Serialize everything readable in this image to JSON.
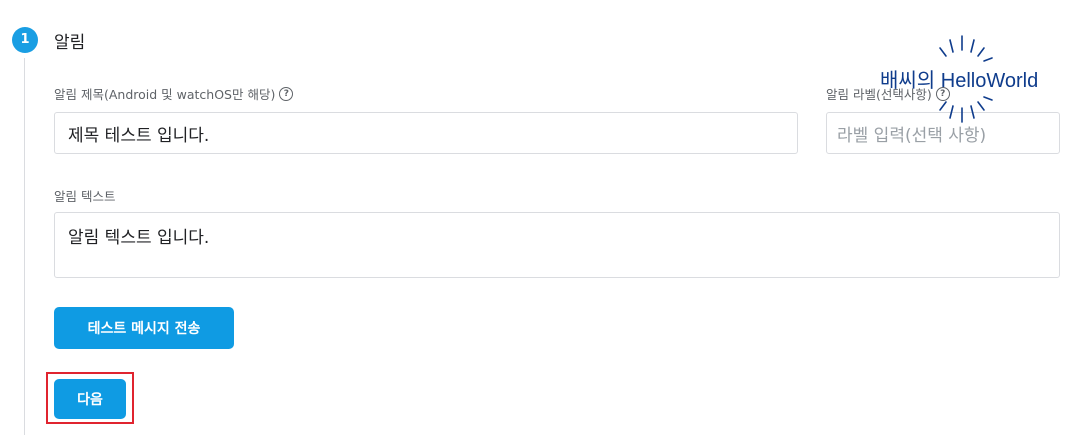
{
  "step": {
    "number": "1",
    "title": "알림"
  },
  "fields": {
    "title_label": "알림 제목(Android 및 watchOS만 해당)",
    "title_value": "제목 테스트 입니다.",
    "badge_label": "알림 라벨(선택사항)",
    "badge_placeholder": "라벨 입력(선택 사항)",
    "text_label": "알림 텍스트",
    "text_value": "알림 텍스트 입니다."
  },
  "buttons": {
    "send_test": "테스트 메시지 전송",
    "next": "다음"
  },
  "watermark": {
    "text": "배씨의 HelloWorld"
  },
  "icons": {
    "help": "question-circle-icon"
  },
  "colors": {
    "primary": "#0f9be3",
    "highlight": "#e0242f",
    "watermark": "#0f3c8c"
  }
}
